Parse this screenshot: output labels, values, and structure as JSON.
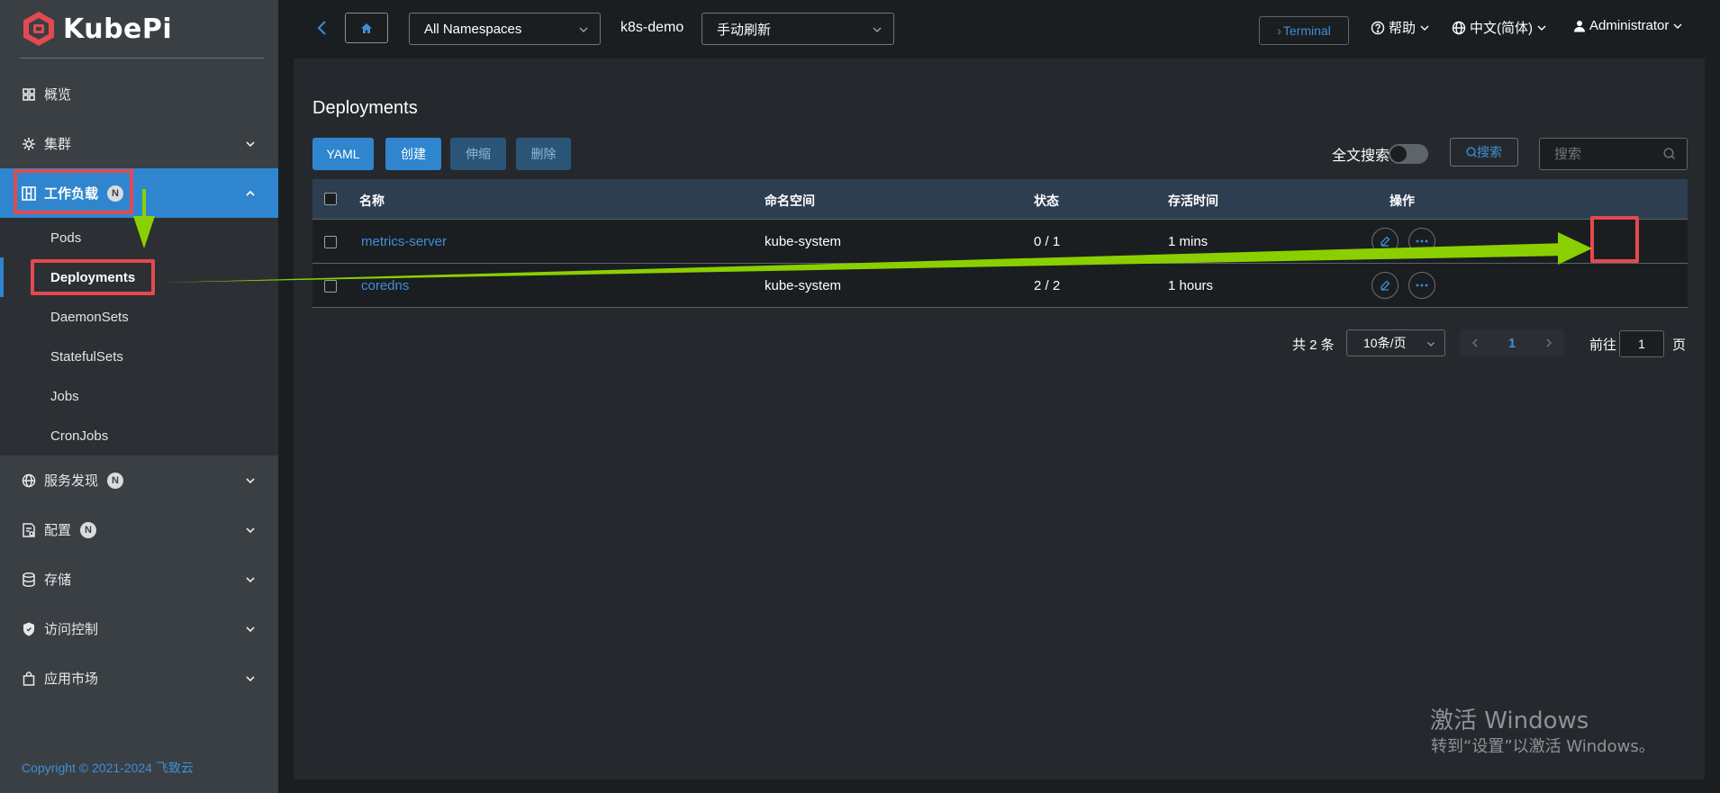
{
  "app": {
    "logo_text": "KubePi",
    "copyright": "Copyright © 2021-2024 飞致云"
  },
  "sidebar": {
    "items": [
      {
        "label": "概览",
        "icon": "dashboard-icon"
      },
      {
        "label": "集群",
        "icon": "cluster-icon"
      },
      {
        "label": "工作负载",
        "icon": "workload-icon",
        "badge": "N",
        "active": true
      },
      {
        "label": "服务发现",
        "icon": "globe-icon",
        "badge": "N"
      },
      {
        "label": "配置",
        "icon": "config-icon",
        "badge": "N"
      },
      {
        "label": "存储",
        "icon": "database-icon"
      },
      {
        "label": "访问控制",
        "icon": "shield-icon"
      },
      {
        "label": "应用市场",
        "icon": "shopping-bag-icon"
      }
    ],
    "sub_items": [
      {
        "label": "Pods"
      },
      {
        "label": "Deployments",
        "active": true
      },
      {
        "label": "DaemonSets"
      },
      {
        "label": "StatefulSets"
      },
      {
        "label": "Jobs"
      },
      {
        "label": "CronJobs"
      }
    ]
  },
  "topbar": {
    "namespace_select": "All Namespaces",
    "cluster_name": "k8s-demo",
    "refresh_select": "手动刷新",
    "terminal_label": "Terminal",
    "help_label": "帮助",
    "language_label": "中文(简体)",
    "user_label": "Administrator"
  },
  "main": {
    "title": "Deployments",
    "buttons": {
      "yaml": "YAML",
      "create": "创建",
      "scale": "伸缩",
      "delete": "删除"
    },
    "full_text_search_label": "全文搜索",
    "search_button": "搜索",
    "search_placeholder": "搜索",
    "table": {
      "headers": [
        "名称",
        "命名空间",
        "状态",
        "存活时间",
        "操作"
      ],
      "rows": [
        {
          "name": "metrics-server",
          "namespace": "kube-system",
          "status": "0 / 1",
          "age": "1 mins"
        },
        {
          "name": "coredns",
          "namespace": "kube-system",
          "status": "2 / 2",
          "age": "1 hours"
        }
      ]
    },
    "pagination": {
      "total": "共 2 条",
      "page_size": "10条/页",
      "current_page": "1",
      "goto_label": "前往",
      "goto_value": "1",
      "page_suffix": "页"
    }
  },
  "watermark": {
    "line1": "激活 Windows",
    "line2": "转到“设置”以激活 Windows。"
  },
  "colors": {
    "accent": "#2f86cf",
    "annotation_red": "#e24a4f",
    "annotation_green": "#8ad000"
  }
}
